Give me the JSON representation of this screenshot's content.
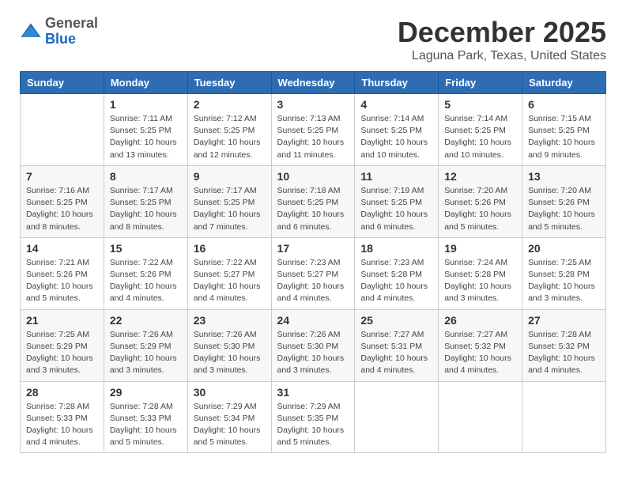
{
  "app": {
    "logo_general": "General",
    "logo_blue": "Blue"
  },
  "header": {
    "title": "December 2025",
    "subtitle": "Laguna Park, Texas, United States"
  },
  "calendar": {
    "days_of_week": [
      "Sunday",
      "Monday",
      "Tuesday",
      "Wednesday",
      "Thursday",
      "Friday",
      "Saturday"
    ],
    "weeks": [
      [
        {
          "date": "",
          "info": ""
        },
        {
          "date": "1",
          "sunrise": "7:11 AM",
          "sunset": "5:25 PM",
          "daylight": "10 hours and 13 minutes."
        },
        {
          "date": "2",
          "sunrise": "7:12 AM",
          "sunset": "5:25 PM",
          "daylight": "10 hours and 12 minutes."
        },
        {
          "date": "3",
          "sunrise": "7:13 AM",
          "sunset": "5:25 PM",
          "daylight": "10 hours and 11 minutes."
        },
        {
          "date": "4",
          "sunrise": "7:14 AM",
          "sunset": "5:25 PM",
          "daylight": "10 hours and 10 minutes."
        },
        {
          "date": "5",
          "sunrise": "7:14 AM",
          "sunset": "5:25 PM",
          "daylight": "10 hours and 10 minutes."
        },
        {
          "date": "6",
          "sunrise": "7:15 AM",
          "sunset": "5:25 PM",
          "daylight": "10 hours and 9 minutes."
        }
      ],
      [
        {
          "date": "7",
          "sunrise": "7:16 AM",
          "sunset": "5:25 PM",
          "daylight": "10 hours and 8 minutes."
        },
        {
          "date": "8",
          "sunrise": "7:17 AM",
          "sunset": "5:25 PM",
          "daylight": "10 hours and 8 minutes."
        },
        {
          "date": "9",
          "sunrise": "7:17 AM",
          "sunset": "5:25 PM",
          "daylight": "10 hours and 7 minutes."
        },
        {
          "date": "10",
          "sunrise": "7:18 AM",
          "sunset": "5:25 PM",
          "daylight": "10 hours and 6 minutes."
        },
        {
          "date": "11",
          "sunrise": "7:19 AM",
          "sunset": "5:25 PM",
          "daylight": "10 hours and 6 minutes."
        },
        {
          "date": "12",
          "sunrise": "7:20 AM",
          "sunset": "5:26 PM",
          "daylight": "10 hours and 5 minutes."
        },
        {
          "date": "13",
          "sunrise": "7:20 AM",
          "sunset": "5:26 PM",
          "daylight": "10 hours and 5 minutes."
        }
      ],
      [
        {
          "date": "14",
          "sunrise": "7:21 AM",
          "sunset": "5:26 PM",
          "daylight": "10 hours and 5 minutes."
        },
        {
          "date": "15",
          "sunrise": "7:22 AM",
          "sunset": "5:26 PM",
          "daylight": "10 hours and 4 minutes."
        },
        {
          "date": "16",
          "sunrise": "7:22 AM",
          "sunset": "5:27 PM",
          "daylight": "10 hours and 4 minutes."
        },
        {
          "date": "17",
          "sunrise": "7:23 AM",
          "sunset": "5:27 PM",
          "daylight": "10 hours and 4 minutes."
        },
        {
          "date": "18",
          "sunrise": "7:23 AM",
          "sunset": "5:28 PM",
          "daylight": "10 hours and 4 minutes."
        },
        {
          "date": "19",
          "sunrise": "7:24 AM",
          "sunset": "5:28 PM",
          "daylight": "10 hours and 3 minutes."
        },
        {
          "date": "20",
          "sunrise": "7:25 AM",
          "sunset": "5:28 PM",
          "daylight": "10 hours and 3 minutes."
        }
      ],
      [
        {
          "date": "21",
          "sunrise": "7:25 AM",
          "sunset": "5:29 PM",
          "daylight": "10 hours and 3 minutes."
        },
        {
          "date": "22",
          "sunrise": "7:26 AM",
          "sunset": "5:29 PM",
          "daylight": "10 hours and 3 minutes."
        },
        {
          "date": "23",
          "sunrise": "7:26 AM",
          "sunset": "5:30 PM",
          "daylight": "10 hours and 3 minutes."
        },
        {
          "date": "24",
          "sunrise": "7:26 AM",
          "sunset": "5:30 PM",
          "daylight": "10 hours and 3 minutes."
        },
        {
          "date": "25",
          "sunrise": "7:27 AM",
          "sunset": "5:31 PM",
          "daylight": "10 hours and 4 minutes."
        },
        {
          "date": "26",
          "sunrise": "7:27 AM",
          "sunset": "5:32 PM",
          "daylight": "10 hours and 4 minutes."
        },
        {
          "date": "27",
          "sunrise": "7:28 AM",
          "sunset": "5:32 PM",
          "daylight": "10 hours and 4 minutes."
        }
      ],
      [
        {
          "date": "28",
          "sunrise": "7:28 AM",
          "sunset": "5:33 PM",
          "daylight": "10 hours and 4 minutes."
        },
        {
          "date": "29",
          "sunrise": "7:28 AM",
          "sunset": "5:33 PM",
          "daylight": "10 hours and 5 minutes."
        },
        {
          "date": "30",
          "sunrise": "7:29 AM",
          "sunset": "5:34 PM",
          "daylight": "10 hours and 5 minutes."
        },
        {
          "date": "31",
          "sunrise": "7:29 AM",
          "sunset": "5:35 PM",
          "daylight": "10 hours and 5 minutes."
        },
        {
          "date": "",
          "info": ""
        },
        {
          "date": "",
          "info": ""
        },
        {
          "date": "",
          "info": ""
        }
      ]
    ],
    "labels": {
      "sunrise": "Sunrise:",
      "sunset": "Sunset:",
      "daylight": "Daylight: "
    }
  }
}
